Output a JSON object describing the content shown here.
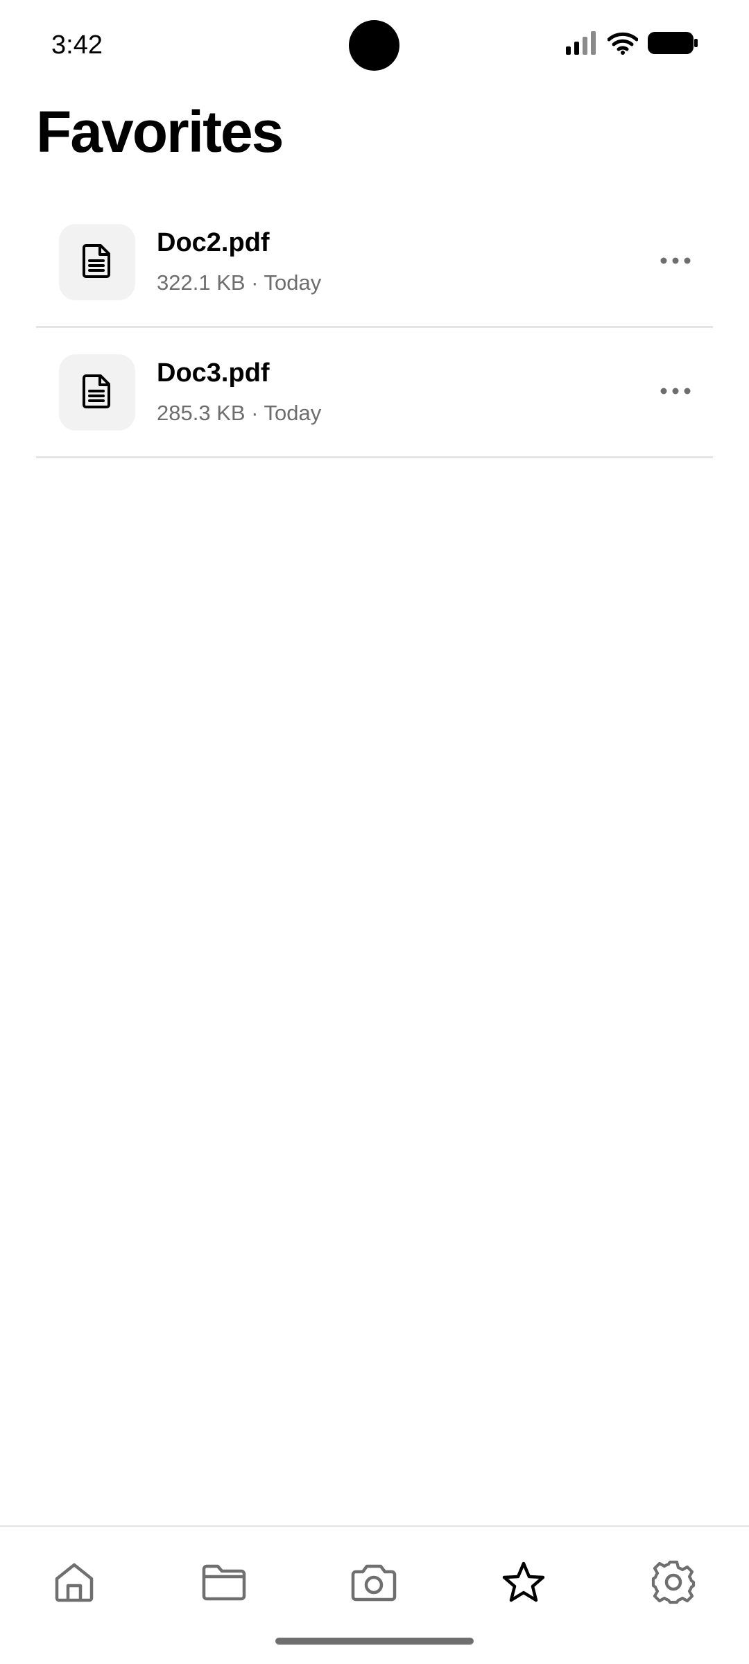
{
  "status_bar": {
    "time": "3:42",
    "icons": [
      "signal-icon",
      "wifi-icon",
      "battery-icon"
    ]
  },
  "page": {
    "title": "Favorites"
  },
  "files": [
    {
      "name": "Doc2.pdf",
      "meta": "322.1 KB · Today",
      "icon": "document-icon"
    },
    {
      "name": "Doc3.pdf",
      "meta": "285.3 KB · Today",
      "icon": "document-icon"
    }
  ],
  "bottom_nav": {
    "items": [
      {
        "icon": "home-icon",
        "active": false
      },
      {
        "icon": "folder-icon",
        "active": false
      },
      {
        "icon": "camera-icon",
        "active": false
      },
      {
        "icon": "star-icon",
        "active": true
      },
      {
        "icon": "gear-icon",
        "active": false
      }
    ]
  },
  "colors": {
    "background": "#ffffff",
    "text_primary": "#000000",
    "text_secondary": "#6d6d6d",
    "divider": "#e4e4e4",
    "thumb_bg": "#f2f2f2",
    "nav_inactive": "#6f6f6f",
    "nav_active": "#000000"
  }
}
